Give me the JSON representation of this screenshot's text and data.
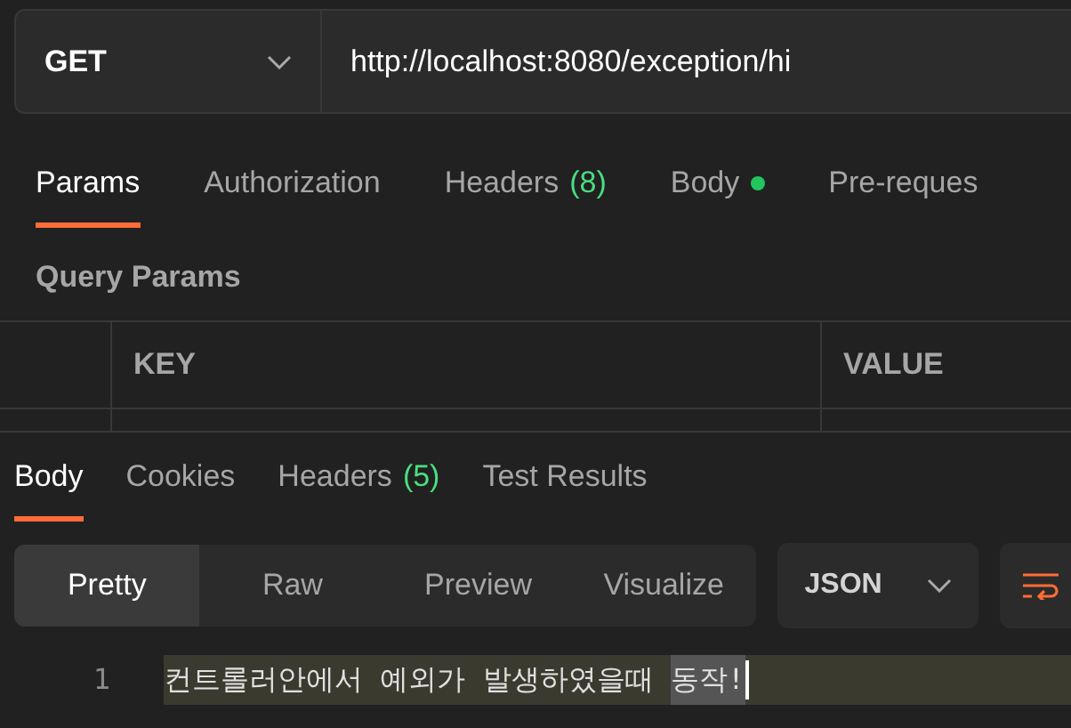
{
  "request": {
    "method": "GET",
    "url": "http://localhost:8080/exception/hi"
  },
  "request_tabs": [
    {
      "label": "Params",
      "selected": true
    },
    {
      "label": "Authorization",
      "selected": false
    },
    {
      "label": "Headers",
      "count": "(8)",
      "selected": false
    },
    {
      "label": "Body",
      "color": "#22c55e",
      "selected": false
    },
    {
      "label": "Pre-reques",
      "selected": false
    }
  ],
  "query_params": {
    "title": "Query Params",
    "columns": [
      "KEY",
      "VALUE"
    ]
  },
  "response_tabs": [
    {
      "label": "Body",
      "selected": true
    },
    {
      "label": "Cookies",
      "selected": false
    },
    {
      "label": "Headers",
      "count": "(5)",
      "selected": false
    },
    {
      "label": "Test Results",
      "selected": false
    }
  ],
  "view_modes": [
    {
      "label": "Pretty",
      "selected": true
    },
    {
      "label": "Raw",
      "selected": false
    },
    {
      "label": "Preview",
      "selected": false
    },
    {
      "label": "Visualize",
      "selected": false
    }
  ],
  "format": "JSON",
  "code_lines": [
    {
      "number": "1",
      "segments": [
        {
          "text": "컨트롤러안에서 예외가 발생하였을때 ",
          "highlighted": false
        },
        {
          "text": "동작!",
          "highlighted": true
        }
      ]
    }
  ]
}
